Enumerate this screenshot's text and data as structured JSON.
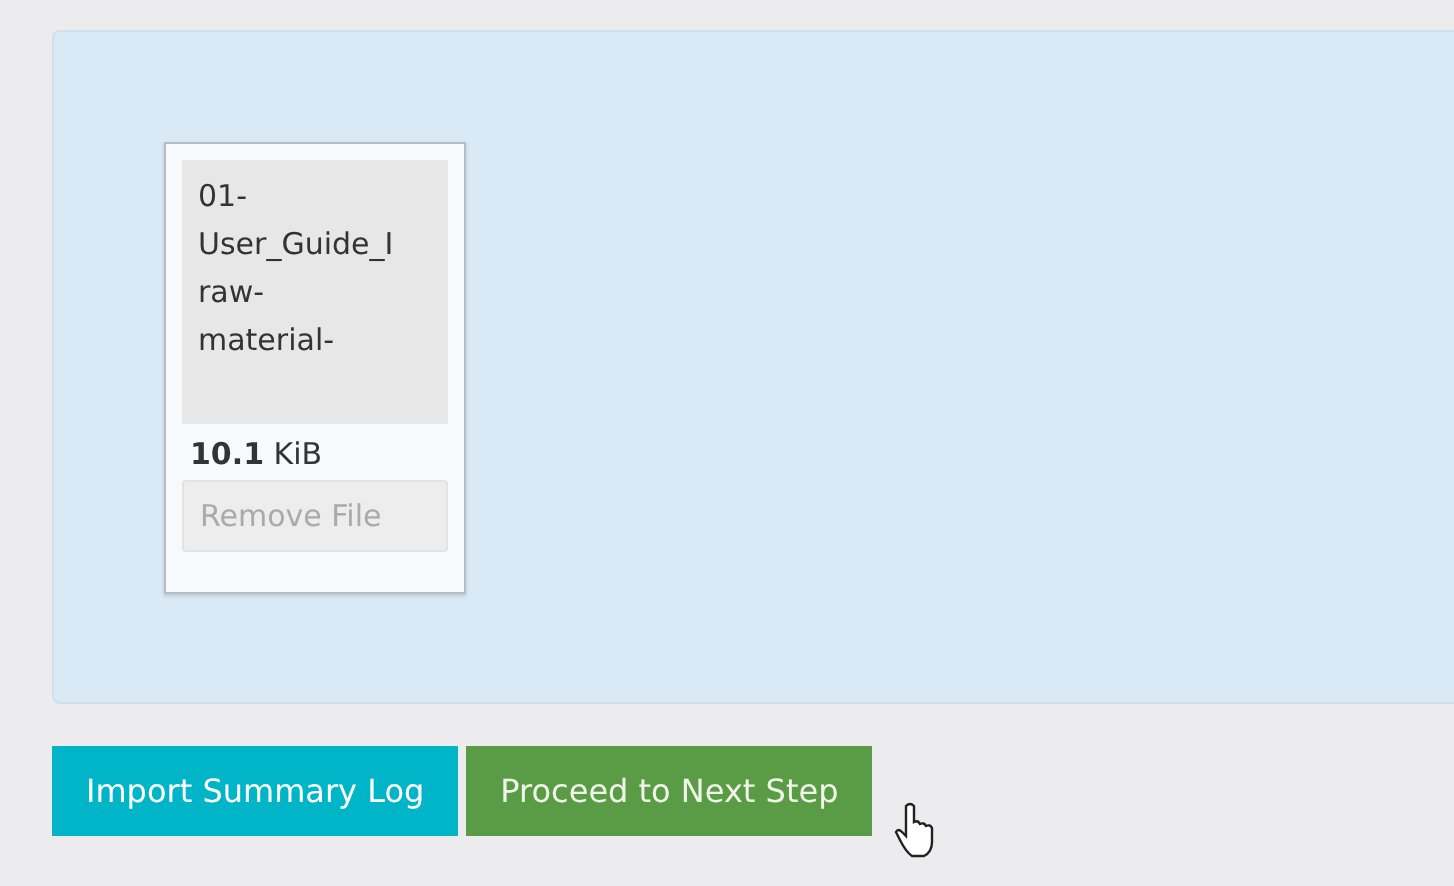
{
  "dropzone": {
    "files": [
      {
        "name_lines": [
          "01-",
          "User_Guide_I",
          "raw-",
          "material-"
        ],
        "size_value": "10.1",
        "size_unit": "KiB",
        "remove_label": "Remove File"
      }
    ]
  },
  "buttons": [
    {
      "label": "Import Summary Log",
      "kind": "info"
    },
    {
      "label": "Proceed to Next Step",
      "kind": "success"
    }
  ]
}
